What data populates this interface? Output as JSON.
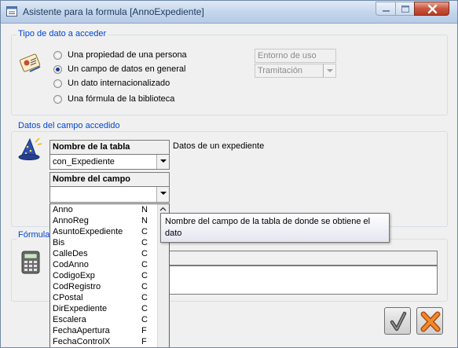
{
  "window": {
    "title": "Asistente para la formula [AnnoExpediente]"
  },
  "tipo": {
    "label": "Tipo de dato a acceder",
    "options": [
      {
        "label": "Una propiedad de una persona",
        "checked": false
      },
      {
        "label": "Un campo de datos en general",
        "checked": true
      },
      {
        "label": "Un dato internacionalizado",
        "checked": false
      },
      {
        "label": "Una fórmula de la biblioteca",
        "checked": false
      }
    ],
    "entorno_value": "Entorno de uso",
    "tramitacion_value": "Tramitación"
  },
  "datos": {
    "label": "Datos del campo accedido",
    "tabla_header": "Nombre de la tabla",
    "tabla_value": "con_Expediente",
    "tabla_desc": "Datos de un expediente",
    "campo_header": "Nombre del campo",
    "campo_value": ""
  },
  "campos": [
    {
      "name": "Anno",
      "type": "N"
    },
    {
      "name": "AnnoReg",
      "type": "N"
    },
    {
      "name": "AsuntoExpediente",
      "type": "C"
    },
    {
      "name": "Bis",
      "type": "C"
    },
    {
      "name": "CalleDes",
      "type": "C"
    },
    {
      "name": "CodAnno",
      "type": "C"
    },
    {
      "name": "CodigoExp",
      "type": "C"
    },
    {
      "name": "CodRegistro",
      "type": "C"
    },
    {
      "name": "CPostal",
      "type": "C"
    },
    {
      "name": "DirExpediente",
      "type": "C"
    },
    {
      "name": "Escalera",
      "type": "C"
    },
    {
      "name": "FechaApertura",
      "type": "F"
    },
    {
      "name": "FechaControlX",
      "type": "F"
    }
  ],
  "formula": {
    "label": "Fórmula"
  },
  "tooltip": {
    "line1": "Nombre del campo de la tabla de donde se obtiene el",
    "line2": "dato"
  },
  "colors": {
    "group_label": "#0046d5",
    "close_button": "#c7573e",
    "accept_icon": "#4a4a4a",
    "cancel_icon": "#e07b1a"
  }
}
